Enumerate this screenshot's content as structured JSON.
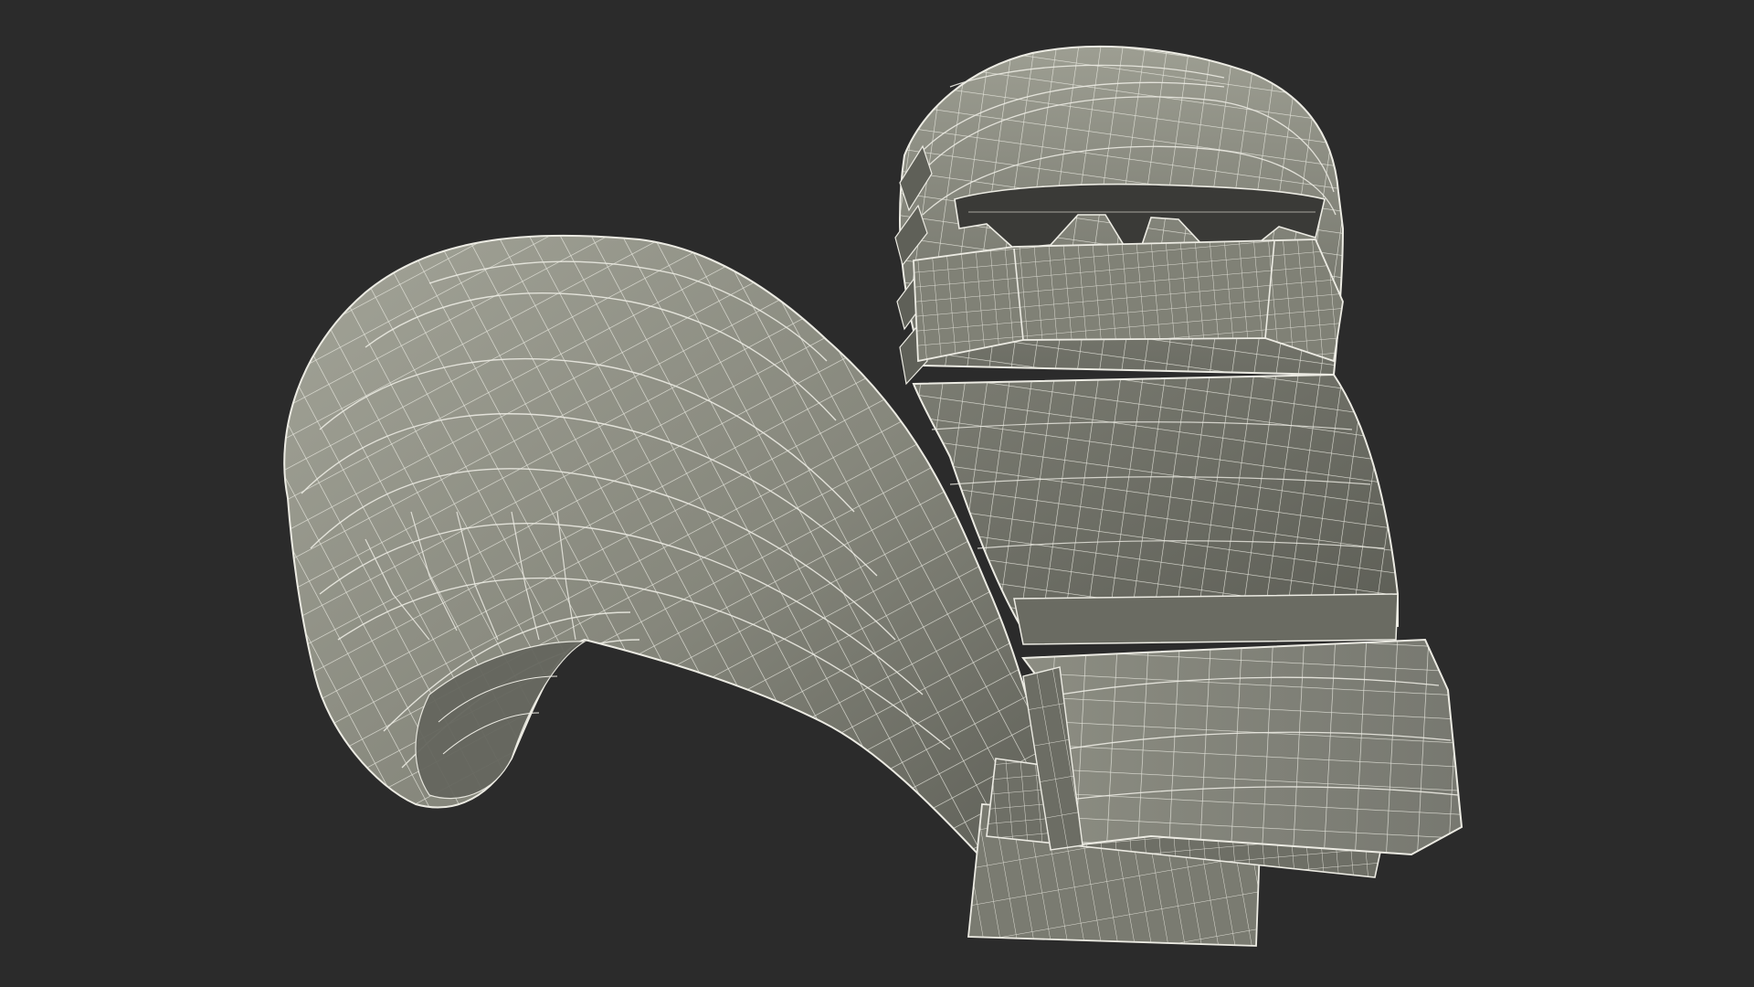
{
  "scene": {
    "subject": "wireframe-3d-model",
    "background_color": "#2b2b2b",
    "surface_color": "#8a8b80",
    "surface_shadow_color": "#5f6058",
    "surface_highlight_color": "#a9aa9e",
    "wire_color": "#ecebe3"
  }
}
